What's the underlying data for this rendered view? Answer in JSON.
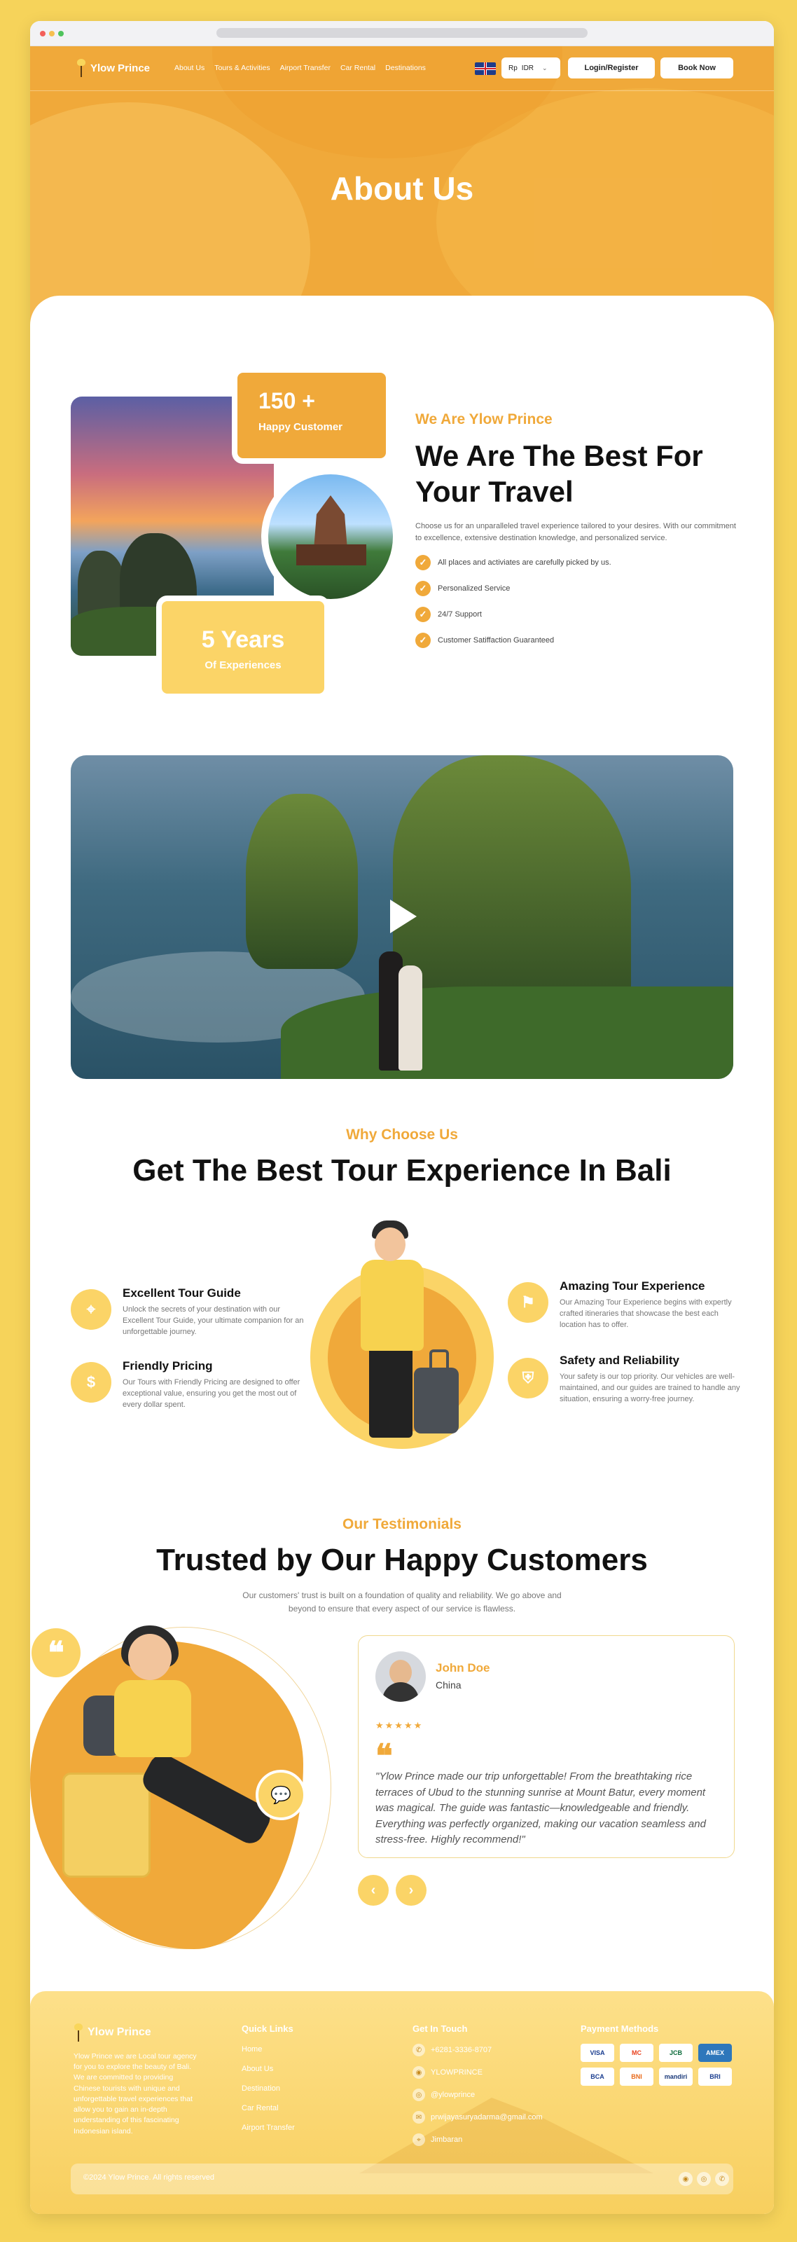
{
  "nav": {
    "brand": "Ylow Prince",
    "links": [
      "About Us",
      "Tours & Activities",
      "Airport Transfer",
      "Car Rental",
      "Destinations"
    ],
    "currency_symbol": "Rp",
    "currency_code": "IDR",
    "login_label": "Login/Register",
    "book_label": "Book Now"
  },
  "hero": {
    "title": "About Us"
  },
  "about": {
    "stat1_value": "150 +",
    "stat1_label": "Happy Customer",
    "stat2_value": "5 Years",
    "stat2_label": "Of Experiences",
    "subtitle": "We Are Ylow Prince",
    "title": "We Are The Best For Your Travel",
    "description": "Choose us for an unparalleled travel experience tailored to your desires. With our commitment to excellence, extensive destination knowledge, and personalized service.",
    "checklist": [
      "All places and activiates are carefully picked by us.",
      "Personalized Service",
      "24/7 Support",
      "Customer Satiffaction Guaranteed"
    ]
  },
  "why": {
    "subtitle": "Why Choose Us",
    "title": "Get The Best Tour Experience In Bali",
    "features": [
      {
        "title": "Excellent Tour Guide",
        "text": "Unlock the secrets of your destination with our Excellent Tour Guide, your ultimate companion for an unforgettable journey."
      },
      {
        "title": "Friendly Pricing",
        "text": "Our Tours with Friendly Pricing are designed to offer exceptional value, ensuring you get the most out of every dollar spent."
      },
      {
        "title": "Amazing Tour Experience",
        "text": "Our Amazing Tour Experience begins with expertly crafted itineraries that showcase the best each location has to offer."
      },
      {
        "title": "Safety and Reliability",
        "text": "Your safety is our top priority. Our vehicles are well-maintained, and our guides are trained to handle any situation, ensuring a worry-free journey."
      }
    ]
  },
  "testimonials": {
    "subtitle": "Our Testimonials",
    "title": "Trusted by Our Happy Customers",
    "description": "Our customers' trust is built on a foundation of quality and reliability. We go above and beyond to ensure that every aspect of our service is flawless.",
    "name": "John Doe",
    "location": "China",
    "stars": "★★★★★",
    "quote": "\"Ylow Prince made our trip unforgettable! From the breathtaking rice terraces of Ubud to the stunning sunrise at Mount Batur, every moment was magical. The guide was fantastic—knowledgeable and friendly. Everything was perfectly organized, making our vacation seamless and stress-free. Highly recommend!\""
  },
  "footer": {
    "brand": "Ylow Prince",
    "about": "Ylow Prince we are Local tour agency for you to explore the beauty of Bali. We are committed to providing Chinese tourists with unique and unforgettable travel experiences that allow you to gain an in-depth understanding of this fascinating Indonesian island.",
    "quick_links_title": "Quick Links",
    "quick_links": [
      "Home",
      "About Us",
      "Destination",
      "Car Rental",
      "Airport Transfer"
    ],
    "contact_title": "Get In Touch",
    "contacts": [
      "+6281-3336-8707",
      "YLOWPRINCE",
      "@ylowprince",
      "prwijayasuryadarma@gmail.com",
      "Jimbaran"
    ],
    "payment_title": "Payment Methods",
    "payments": [
      "VISA",
      "MC",
      "JCB",
      "AMEX",
      "BCA",
      "BNI",
      "mandiri",
      "BRI"
    ],
    "copyright": "©2024 Ylow Prince. All rights reserved"
  }
}
